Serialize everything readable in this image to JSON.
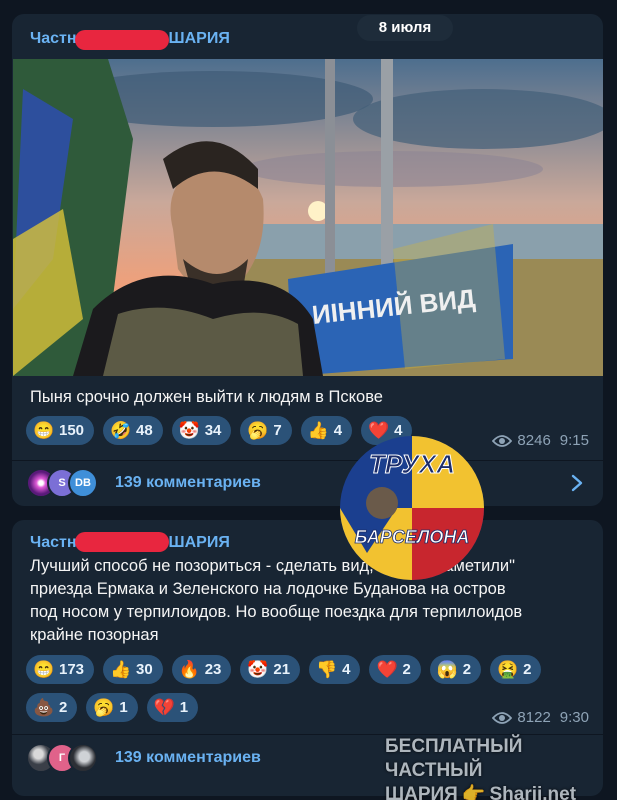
{
  "date_pill": "8 июля",
  "posts": [
    {
      "author_prefix": "Частн",
      "author_suffix": "ШАРИЯ",
      "text": "Пыня срочно должен выйти к людям в Пскове",
      "reactions": [
        {
          "emoji": "😁",
          "count": "150"
        },
        {
          "emoji": "🤣",
          "count": "48"
        },
        {
          "emoji": "🤡",
          "count": "34"
        },
        {
          "emoji": "🥱",
          "count": "7"
        },
        {
          "emoji": "👍",
          "count": "4"
        },
        {
          "emoji": "❤️",
          "count": "4"
        }
      ],
      "views": "8246",
      "time": "9:15",
      "comments": "139 комментариев",
      "avatars": [
        "",
        "S",
        "DB"
      ],
      "photo_sign_text": "ИІННИЙ ВИД"
    },
    {
      "author_prefix": "Частн",
      "author_suffix": "ШАРИЯ",
      "text_lines": [
        "Лучший способ не позориться - сделать вид, что \"не заметили\"",
        "приезда Ермака и Зеленского на лодочке Буданова на остров",
        "под носом у терпилоидов. Но вообще поездка для терпилоидов",
        "крайне позорная"
      ],
      "reactions": [
        {
          "emoji": "😁",
          "count": "173"
        },
        {
          "emoji": "👍",
          "count": "30"
        },
        {
          "emoji": "🔥",
          "count": "23"
        },
        {
          "emoji": "🤡",
          "count": "21"
        },
        {
          "emoji": "👎",
          "count": "4"
        },
        {
          "emoji": "❤️",
          "count": "2"
        },
        {
          "emoji": "😱",
          "count": "2"
        },
        {
          "emoji": "🤮",
          "count": "2"
        },
        {
          "emoji": "💩",
          "count": "2"
        },
        {
          "emoji": "🥱",
          "count": "1"
        },
        {
          "emoji": "💔",
          "count": "1"
        }
      ],
      "views": "8122",
      "time": "9:30",
      "comments": "139 комментариев",
      "avatars": [
        "",
        "Г",
        ""
      ]
    }
  ],
  "watermark": {
    "logo_top": "ТРУХА",
    "logo_bottom": "БАРСЕЛОНА",
    "line1": "БЕСПЛАТНЫЙ ЧАСТНЫЙ",
    "line2_a": "ШАРИЯ",
    "line2_b": "Sharij.net"
  },
  "colors": {
    "background": "#0e1621",
    "bubble": "#182533",
    "accent": "#6ab2f2",
    "reaction_bg": "#2b5278",
    "redaction": "#e8263f"
  }
}
